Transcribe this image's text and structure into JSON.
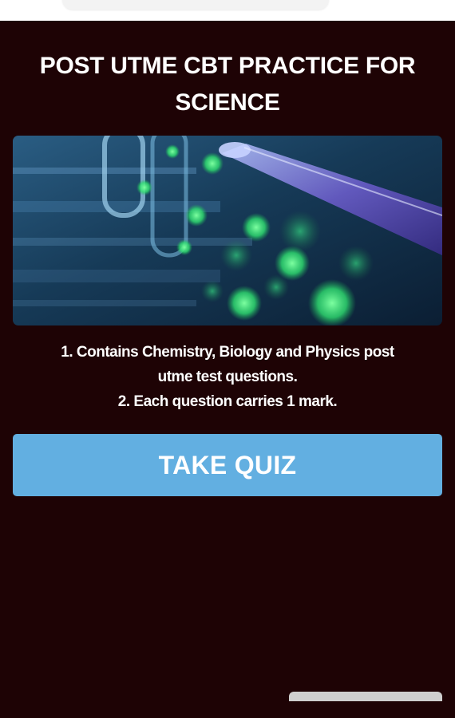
{
  "header": {
    "title_line1": "POST UTME CBT PRACTICE FOR",
    "title_line2": "SCIENCE"
  },
  "hero_image": {
    "icon": "laboratory-test-tubes-image"
  },
  "description": {
    "line1": "1. Contains Chemistry, Biology and Physics post",
    "line2": "utme test questions.",
    "line3": "2. Each question carries 1 mark."
  },
  "quiz_button": {
    "label": "TAKE QUIZ"
  },
  "colors": {
    "panel_background": "#1e0305",
    "button_background": "#62afe1",
    "text": "#ffffff"
  }
}
